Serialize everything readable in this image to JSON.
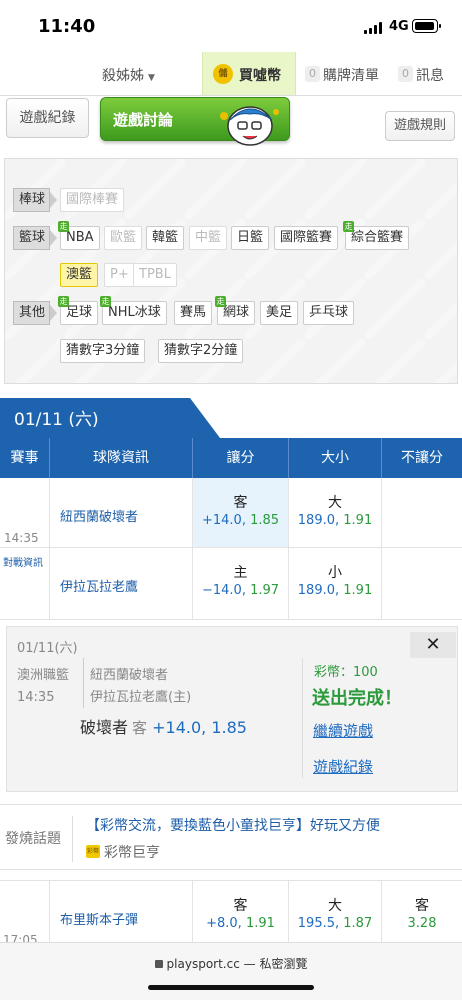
{
  "status": {
    "time": "11:40",
    "network": "4G"
  },
  "topnav": {
    "user": "殺姊姊",
    "coin_icon": "儲",
    "coin_label": "買噓幣",
    "cart_count": "0",
    "cart_label": "購牌清單",
    "msg_count": "0",
    "msg_label": "訊息"
  },
  "toolbar": {
    "record": "遊戲紀錄",
    "discuss": "遊戲討論",
    "rules": "遊戲規則"
  },
  "filter": {
    "cat_baseball": "棒球",
    "baseball": [
      "國際棒賽"
    ],
    "cat_basketball": "籃球",
    "basketball": [
      "NBA",
      "歐籃",
      "韓籃",
      "中籃",
      "日籃",
      "國際籃賽",
      "綜合籃賽",
      "澳籃",
      "P+",
      "TPBL"
    ],
    "cat_other": "其他",
    "other": [
      "足球",
      "NHL冰球",
      "賽馬",
      "網球",
      "美足",
      "乒乓球",
      "猜數字3分鐘",
      "猜數字2分鐘"
    ],
    "walk_badge": "走"
  },
  "date": "01/11 (六)",
  "table": {
    "headers": [
      "賽事",
      "球隊資訊",
      "讓分",
      "大小",
      "不讓分"
    ],
    "matches": [
      {
        "time": "14:35",
        "info_link": "對戰資訊",
        "away": "紐西蘭破壞者",
        "home": "伊拉瓦拉老鷹",
        "spread_away": {
          "side": "客",
          "line": "+14.0",
          "odds": "1.85"
        },
        "spread_home": {
          "side": "主",
          "line": "−14.0",
          "odds": "1.97"
        },
        "total_over": {
          "side": "大",
          "line": "189.0",
          "odds": "1.91"
        },
        "total_under": {
          "side": "小",
          "line": "189.0",
          "odds": "1.91"
        }
      },
      {
        "time": "17:05",
        "away": "布里斯本子彈",
        "spread_away": {
          "side": "客",
          "line": "+8.0",
          "odds": "1.91"
        },
        "total_over": {
          "side": "大",
          "line": "195.5",
          "odds": "1.87"
        },
        "moneyline_away": {
          "side": "客",
          "odds": "3.28"
        }
      }
    ]
  },
  "popup": {
    "date": "01/11(六)",
    "league": "澳洲職籃",
    "time": "14:35",
    "team_away": "紐西蘭破壞者",
    "team_home": "伊拉瓦拉老鷹(主)",
    "pick_team": "破壞者",
    "pick_side": "客",
    "pick_line": "+14.0, 1.85",
    "coin": "彩幣：100",
    "sent": "送出完成！",
    "continue": "繼續遊戲",
    "record": "遊戲紀錄",
    "close": "✕"
  },
  "hot": {
    "label": "發燒話題",
    "title": "【彩幣交流，要換藍色小童找巨亨】好玩又方便",
    "author_icon": "彩幣",
    "author": "彩幣巨亨"
  },
  "browser": {
    "url": "playsport.cc — 私密瀏覽"
  },
  "colors": {
    "brand_blue": "#1e63ae",
    "green": "#4cae2a",
    "odds_blue": "#1e6bc0"
  }
}
